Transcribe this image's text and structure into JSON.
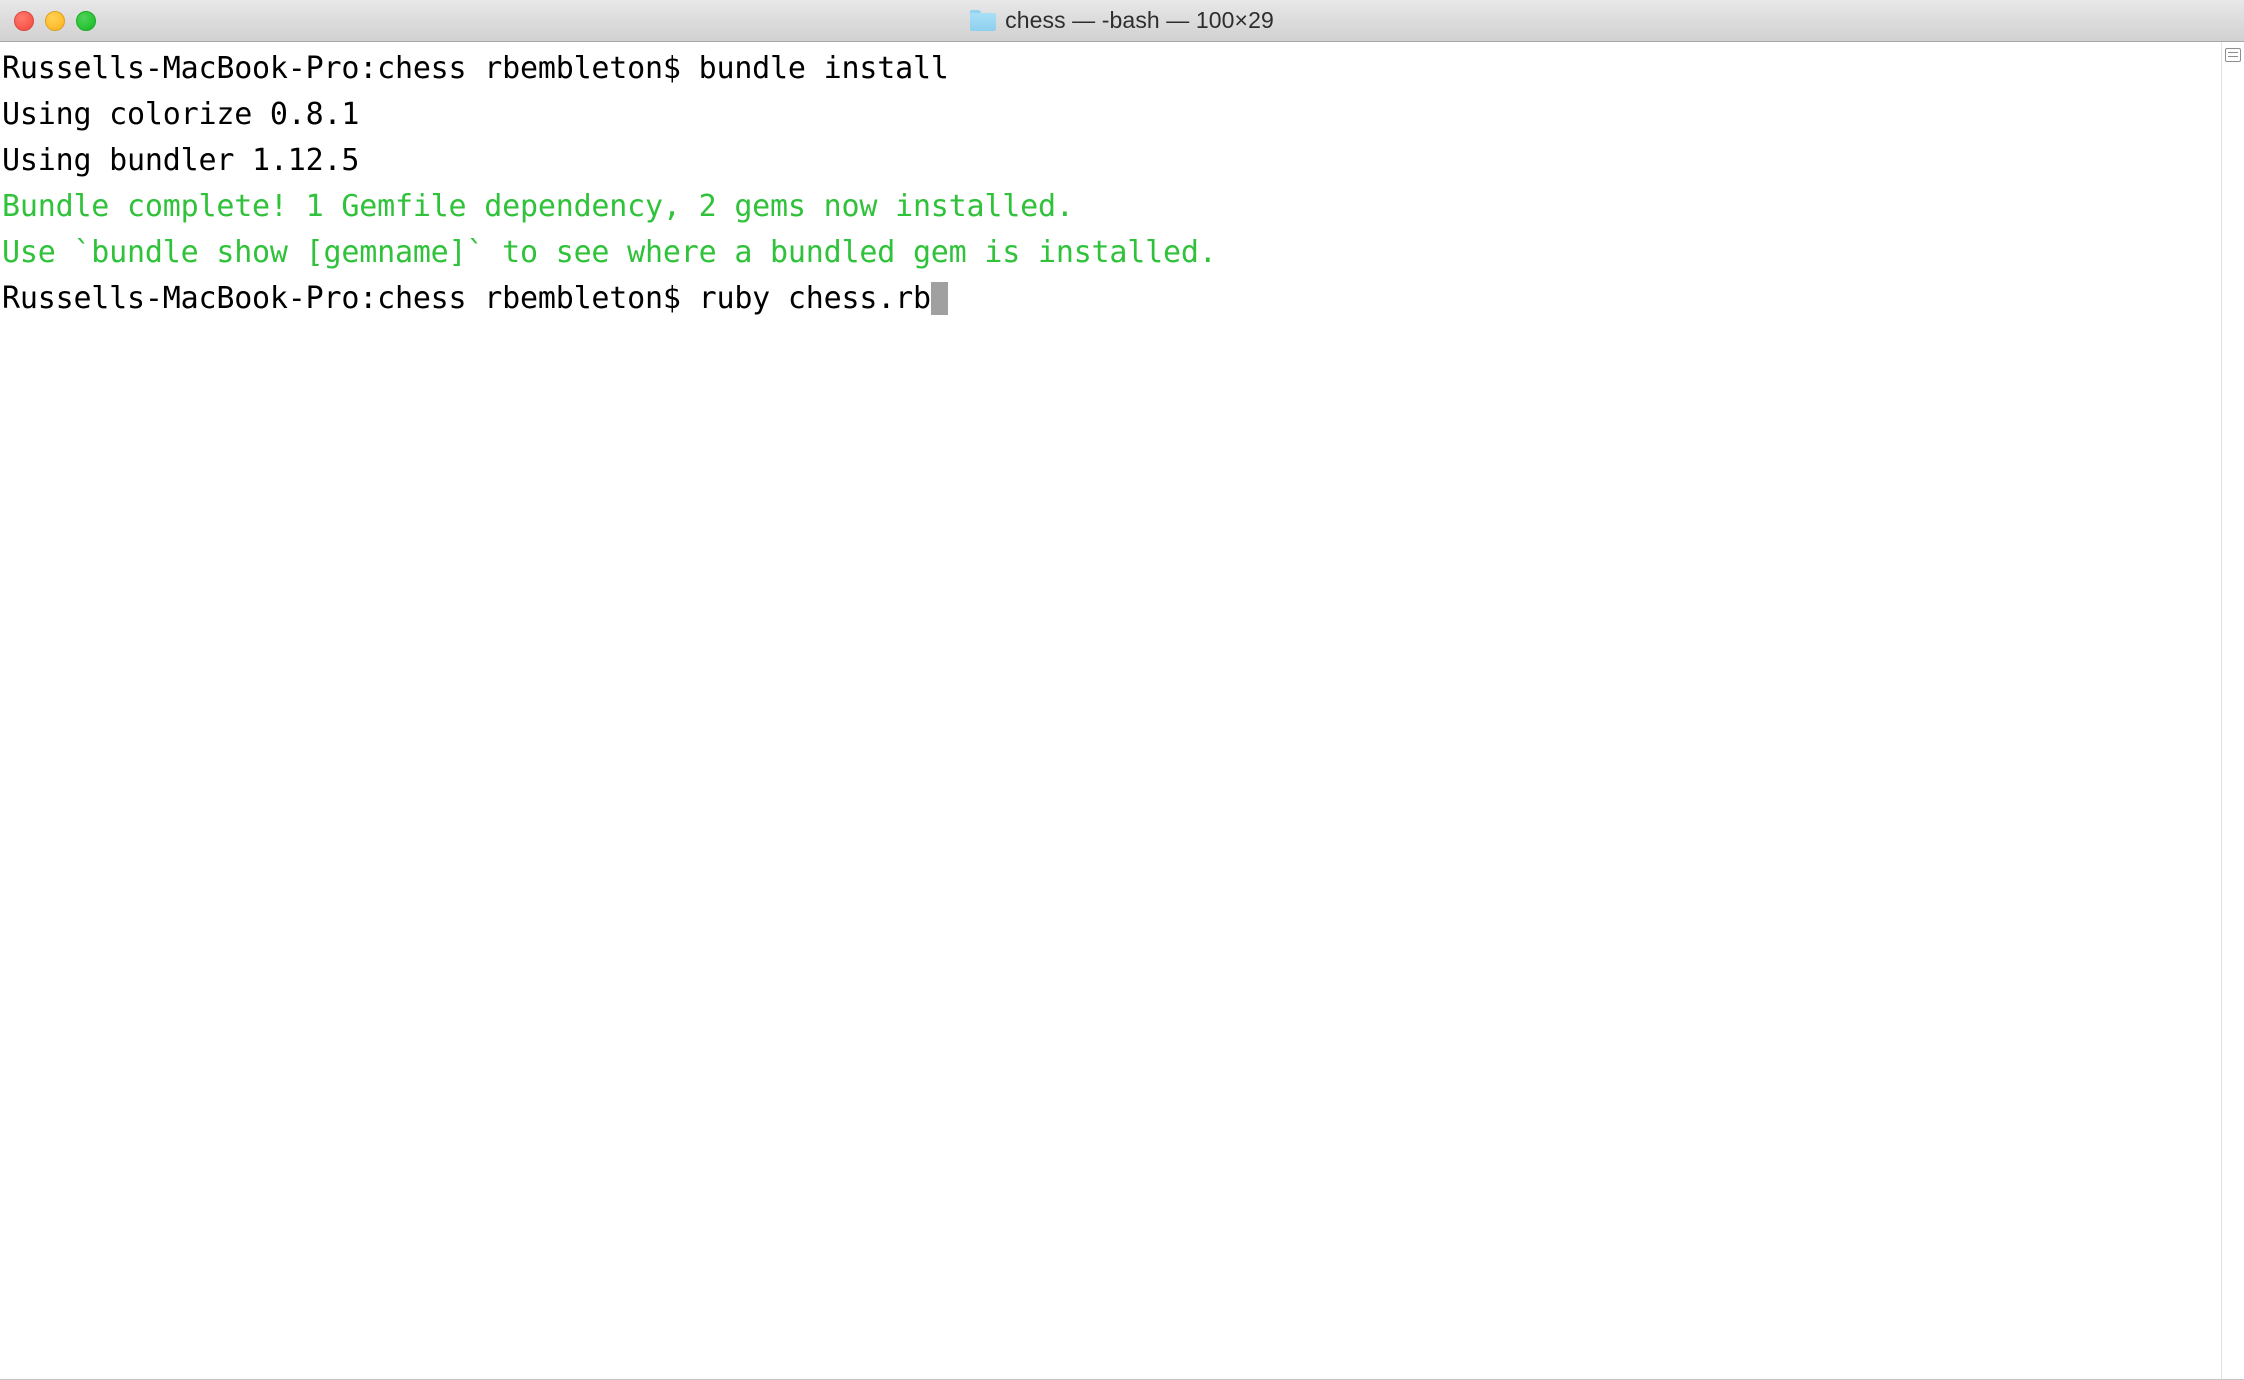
{
  "window": {
    "title": "chess — -bash — 100×29",
    "folder_name": "chess",
    "shell": "-bash",
    "size": "100×29",
    "controls": {
      "close_label": "",
      "minimize_label": "",
      "zoom_label": ""
    }
  },
  "colors": {
    "text": "#000000",
    "success_green": "#2fc23a",
    "cursor": "#a0a0a0",
    "background": "#ffffff",
    "titlebar": "#dcdcdc",
    "close_button": "#f9594e",
    "minimize_button": "#ffbd2e",
    "zoom_button": "#29c436",
    "folder_icon": "#8fd0ef"
  },
  "terminal": {
    "prompt": "Russells-MacBook-Pro:chess rbembleton$",
    "lines": [
      {
        "text": "Russells-MacBook-Pro:chess rbembleton$ bundle install",
        "color": "default"
      },
      {
        "text": "Using colorize 0.8.1",
        "color": "default"
      },
      {
        "text": "Using bundler 1.12.5",
        "color": "default"
      },
      {
        "text": "Bundle complete! 1 Gemfile dependency, 2 gems now installed.",
        "color": "green"
      },
      {
        "text": "Use `bundle show [gemname]` to see where a bundled gem is installed.",
        "color": "green"
      },
      {
        "text": "Russells-MacBook-Pro:chess rbembleton$ ruby chess.rb",
        "color": "default",
        "cursor": true
      }
    ]
  }
}
